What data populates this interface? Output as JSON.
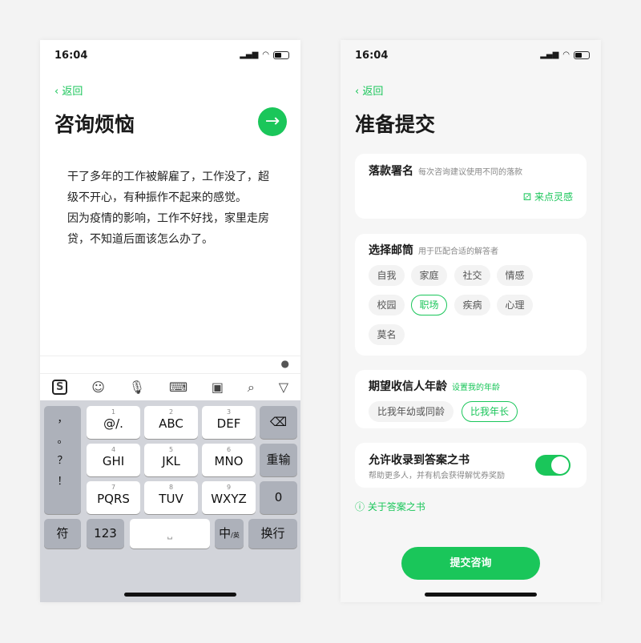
{
  "status": {
    "time": "16:04"
  },
  "left": {
    "back": "返回",
    "title": "咨询烦恼",
    "next_icon": "arrow-right-icon",
    "content": [
      "干了多年的工作被解雇了，工作没了，超",
      "级不开心，有种振作不起来的感觉。",
      "因为疫情的影响，工作不好找，家里走房",
      "贷，不知道后面该怎么办了。"
    ],
    "keyboard": {
      "left_col": [
        "，",
        "。",
        "？",
        "！"
      ],
      "keys": [
        {
          "num": "1",
          "label": "@/."
        },
        {
          "num": "2",
          "label": "ABC"
        },
        {
          "num": "3",
          "label": "DEF"
        },
        {
          "num": "4",
          "label": "GHI"
        },
        {
          "num": "5",
          "label": "JKL"
        },
        {
          "num": "6",
          "label": "MNO"
        },
        {
          "num": "7",
          "label": "PQRS"
        },
        {
          "num": "8",
          "label": "TUV"
        },
        {
          "num": "9",
          "label": "WXYZ"
        }
      ],
      "reinput": "重输",
      "zero": "0",
      "symbols": "符",
      "num": "123",
      "lang": "中",
      "lang_sub": "/英",
      "newline": "换行"
    }
  },
  "right": {
    "back": "返回",
    "title": "准备提交",
    "signature": {
      "label": "落款署名",
      "hint": "每次咨询建议使用不同的落款",
      "inspire": "来点灵感"
    },
    "mailbox": {
      "label": "选择邮筒",
      "hint": "用于匹配合适的解答者",
      "tags": [
        "自我",
        "家庭",
        "社交",
        "情感",
        "校园",
        "职场",
        "疾病",
        "心理",
        "莫名"
      ],
      "selected": "职场"
    },
    "age": {
      "label": "期望收信人年龄",
      "link": "设置我的年龄",
      "options": [
        "比我年幼或同龄",
        "比我年长"
      ],
      "selected": "比我年长"
    },
    "book": {
      "label": "允许收录到答案之书",
      "desc": "帮助更多人，并有机会获得解忧券奖励",
      "enabled": true
    },
    "about": "关于答案之书",
    "submit": "提交咨询"
  },
  "colors": {
    "accent": "#1ac65a"
  }
}
